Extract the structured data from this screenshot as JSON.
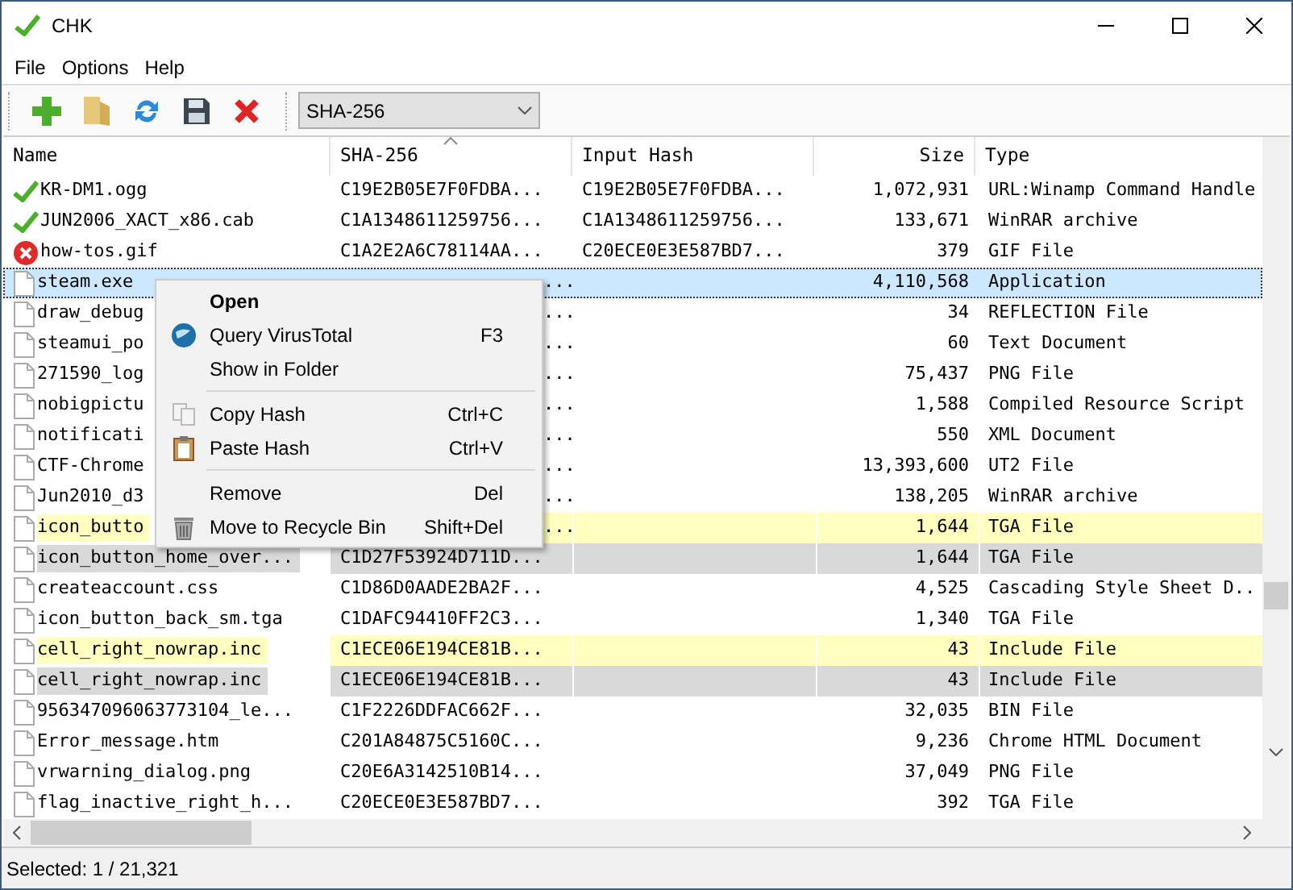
{
  "window": {
    "title": "CHK"
  },
  "menu": [
    "File",
    "Options",
    "Help"
  ],
  "hash_select": {
    "value": "SHA-256"
  },
  "table": {
    "columns": [
      {
        "label": "Name",
        "sorted": false
      },
      {
        "label": "SHA-256",
        "sorted": true
      },
      {
        "label": "Input Hash",
        "sorted": false
      },
      {
        "label": "Size",
        "sorted": false
      },
      {
        "label": "Type",
        "sorted": false
      }
    ],
    "rows": [
      {
        "kind": "ok",
        "name": "KR-DM1.ogg",
        "hash": "C19E2B05E7F0FDBA...",
        "input": "C19E2B05E7F0FDBA...",
        "size": "1,072,931",
        "type": "URL:Winamp Command Handle",
        "selected": false
      },
      {
        "kind": "ok",
        "name": "JUN2006_XACT_x86.cab",
        "hash": "C1A1348611259756...",
        "input": "C1A1348611259756...",
        "size": "133,671",
        "type": "WinRAR archive",
        "selected": false
      },
      {
        "kind": "bad",
        "name": "how-tos.gif",
        "hash": "C1A2E2A6C78114AA...",
        "input": "C20ECE0E3E587BD7...",
        "size": "379",
        "type": "GIF File",
        "selected": false
      },
      {
        "kind": "file",
        "name": "steam.exe",
        "hash_tail": "...",
        "size": "4,110,568",
        "type": "Application",
        "selected": true
      },
      {
        "kind": "file",
        "name": "draw_debug",
        "hash_tail": "...",
        "size": "34",
        "type": "REFLECTION File",
        "selected": false
      },
      {
        "kind": "file",
        "name": "steamui_po",
        "hash_tail": "...",
        "size": "60",
        "type": "Text Document",
        "selected": false
      },
      {
        "kind": "file",
        "name": "271590_log",
        "hash_tail": "...",
        "size": "75,437",
        "type": "PNG File",
        "selected": false
      },
      {
        "kind": "file",
        "name": "nobigpictu",
        "hash_tail": "...",
        "size": "1,588",
        "type": "Compiled Resource Script",
        "selected": false
      },
      {
        "kind": "file",
        "name": "notificati",
        "hash_tail": "...",
        "size": "550",
        "type": "XML Document",
        "selected": false
      },
      {
        "kind": "file",
        "name": "CTF-Chrome",
        "hash_tail": "...",
        "size": "13,393,600",
        "type": "UT2 File",
        "selected": false
      },
      {
        "kind": "file",
        "name": "Jun2010_d3",
        "hash_tail": "...",
        "size": "138,205",
        "type": "WinRAR archive",
        "selected": false
      },
      {
        "kind": "file",
        "name": "icon_butto",
        "hash_tail": "...",
        "size": "1,644",
        "type": "TGA File",
        "selected": false,
        "color": "#ffffc0"
      },
      {
        "kind": "file",
        "name": "icon_button_home_over...",
        "hash": "C1D27F53924D711D...",
        "size": "1,644",
        "type": "TGA File",
        "selected": false,
        "color": "#d9d9d9"
      },
      {
        "kind": "file",
        "name": "createaccount.css",
        "hash": "C1D86D0AADE2BA2F...",
        "size": "4,525",
        "type": "Cascading Style Sheet D..",
        "selected": false
      },
      {
        "kind": "file",
        "name": "icon_button_back_sm.tga",
        "hash": "C1DAFC94410FF2C3...",
        "size": "1,340",
        "type": "TGA File",
        "selected": false
      },
      {
        "kind": "file",
        "name": "cell_right_nowrap.inc",
        "hash": "C1ECE06E194CE81B...",
        "size": "43",
        "type": "Include File",
        "selected": false,
        "color": "#ffffc0"
      },
      {
        "kind": "file",
        "name": "cell_right_nowrap.inc",
        "hash": "C1ECE06E194CE81B...",
        "size": "43",
        "type": "Include File",
        "selected": false,
        "color": "#d9d9d9"
      },
      {
        "kind": "file",
        "name": "956347096063773104_le...",
        "hash": "C1F2226DDFAC662F...",
        "size": "32,035",
        "type": "BIN File",
        "selected": false
      },
      {
        "kind": "file",
        "name": "Error_message.htm",
        "hash": "C201A84875C5160C...",
        "size": "9,236",
        "type": "Chrome HTML Document",
        "selected": false
      },
      {
        "kind": "file",
        "name": "vrwarning_dialog.png",
        "hash": "C20E6A3142510B14...",
        "size": "37,049",
        "type": "PNG File",
        "selected": false
      },
      {
        "kind": "file",
        "name": "flag_inactive_right_h...",
        "hash": "C20ECE0E3E587BD7...",
        "size": "392",
        "type": "TGA File",
        "selected": false
      }
    ]
  },
  "context_menu": [
    {
      "kind": "plain",
      "label": "Open",
      "bold": true
    },
    {
      "kind": "globe",
      "label": "Query VirusTotal",
      "shortcut": "F3",
      "bold": false
    },
    {
      "kind": "plain",
      "label": "Show in Folder",
      "bold": false
    },
    {
      "kind": "separator"
    },
    {
      "kind": "copy",
      "label": "Copy Hash",
      "shortcut": "Ctrl+C",
      "bold": false
    },
    {
      "kind": "paste",
      "label": "Paste Hash",
      "shortcut": "Ctrl+V",
      "bold": false
    },
    {
      "kind": "separator"
    },
    {
      "kind": "plain",
      "label": "Remove",
      "shortcut": "Del",
      "bold": false
    },
    {
      "kind": "trash",
      "label": "Move to Recycle Bin",
      "shortcut": "Shift+Del",
      "bold": false
    }
  ],
  "status_bar": "Selected: 1 / 21,321"
}
